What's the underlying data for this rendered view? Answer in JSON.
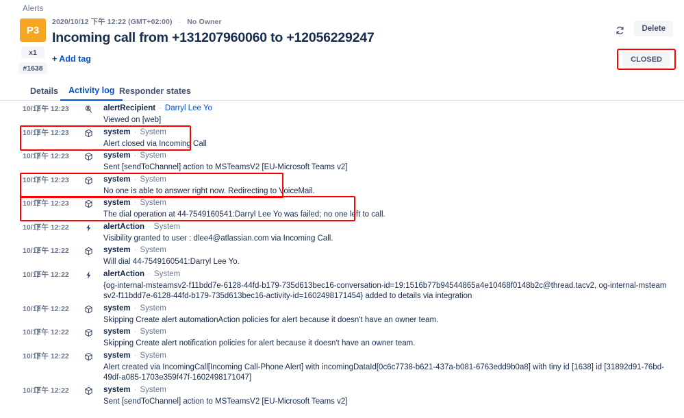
{
  "breadcrumb": "Alerts",
  "colors": {
    "priority_badge": "#f6a623",
    "link": "#0052cc",
    "highlight": "#ff0000",
    "text": "#172b4d",
    "muted": "#6b778c"
  },
  "header": {
    "priority": "P3",
    "count": "x1",
    "alert_id": "#1638",
    "timestamp": "2020/10/12 下午 12:22 (GMT+02:00)",
    "meta_separator": "·",
    "owner": "No Owner",
    "title": "Incoming call from +131207960060 to +12056229247",
    "add_tag_label": "+ Add tag",
    "refresh_icon": "refresh-icon",
    "delete_label": "Delete",
    "status_label": "CLOSED"
  },
  "tabs": [
    {
      "label": "Details",
      "active": false
    },
    {
      "label": "Activity log",
      "active": true
    },
    {
      "label": "Responder states",
      "active": false
    }
  ],
  "activity_log": [
    {
      "date": "10/12",
      "time": "下午 12:23",
      "icon": "view-person-icon",
      "type": "alertRecipient",
      "actor": "Darryl Lee Yo",
      "actor_is_link": true,
      "text": "Viewed on [web]",
      "highlighted": false
    },
    {
      "date": "10/12",
      "time": "下午 12:23",
      "icon": "cube-icon",
      "type": "system",
      "actor": "System",
      "actor_is_link": false,
      "text": "Alert closed via Incoming Call",
      "highlighted": true
    },
    {
      "date": "10/12",
      "time": "下午 12:23",
      "icon": "cube-icon",
      "type": "system",
      "actor": "System",
      "actor_is_link": false,
      "text": "Sent [sendToChannel] action to MSTeamsV2 [EU-Microsoft Teams v2]",
      "highlighted": false
    },
    {
      "date": "10/12",
      "time": "下午 12:23",
      "icon": "cube-icon",
      "type": "system",
      "actor": "System",
      "actor_is_link": false,
      "text": "No one is able to answer right now. Redirecting to VoiceMail.",
      "highlighted": true
    },
    {
      "date": "10/12",
      "time": "下午 12:23",
      "icon": "cube-icon",
      "type": "system",
      "actor": "System",
      "actor_is_link": false,
      "text": "The dial operation at 44-7549160541:Darryl Lee Yo was failed; no one left to call.",
      "highlighted": true
    },
    {
      "date": "10/12",
      "time": "下午 12:22",
      "icon": "lightning-icon",
      "type": "alertAction",
      "actor": "System",
      "actor_is_link": false,
      "text": "Visibility granted to user : dlee4@atlassian.com via Incoming Call.",
      "highlighted": false
    },
    {
      "date": "10/12",
      "time": "下午 12:22",
      "icon": "cube-icon",
      "type": "system",
      "actor": "System",
      "actor_is_link": false,
      "text": "Will dial 44-7549160541:Darryl Lee Yo.",
      "highlighted": false
    },
    {
      "date": "10/12",
      "time": "下午 12:22",
      "icon": "lightning-icon",
      "type": "alertAction",
      "actor": "System",
      "actor_is_link": false,
      "text": "{og-internal-msteamsv2-f11bdd7e-6128-44fd-b179-735d613bec16-conversation-id=19:1516b77b94544865a4e10468f0148b2c@thread.tacv2, og-internal-msteamsv2-f11bdd7e-6128-44fd-b179-735d613bec16-activity-id=1602498171454} added to details via integration",
      "highlighted": false
    },
    {
      "date": "10/12",
      "time": "下午 12:22",
      "icon": "cube-icon",
      "type": "system",
      "actor": "System",
      "actor_is_link": false,
      "text": "Skipping Create alert automationAction policies for alert because it doesn't have an owner team.",
      "highlighted": false
    },
    {
      "date": "10/12",
      "time": "下午 12:22",
      "icon": "cube-icon",
      "type": "system",
      "actor": "System",
      "actor_is_link": false,
      "text": "Skipping Create alert notification policies for alert because it doesn't have an owner team.",
      "highlighted": false
    },
    {
      "date": "10/12",
      "time": "下午 12:22",
      "icon": "cube-icon",
      "type": "system",
      "actor": "System",
      "actor_is_link": false,
      "text": "Alert created via IncomingCall[Incoming Call-Phone Alert] with incomingDataId[0c6c7738-b621-437a-b081-6763edd9b0a8] with tiny id [1638] id [31892d91-76bd-49df-a085-1703e359f47f-1602498171047]",
      "highlighted": false
    },
    {
      "date": "10/12",
      "time": "下午 12:22",
      "icon": "cube-icon",
      "type": "system",
      "actor": "System",
      "actor_is_link": false,
      "text": "Sent [sendToChannel] action to MSTeamsV2 [EU-Microsoft Teams v2]",
      "highlighted": false
    }
  ]
}
